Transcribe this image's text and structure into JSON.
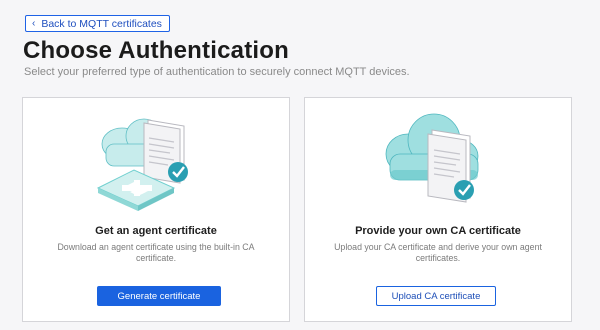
{
  "back_link": {
    "label": "Back to MQTT certificates"
  },
  "header": {
    "title": "Choose Authentication",
    "subtitle": "Select your preferred type of authentication to securely connect MQTT devices."
  },
  "cards": [
    {
      "title": "Get an agent certificate",
      "description": "Download an agent certificate using the built-in CA certificate.",
      "button_label": "Generate certificate"
    },
    {
      "title": "Provide your own CA certificate",
      "description": "Upload your CA certificate and derive your own agent certificates.",
      "button_label": "Upload CA certificate"
    }
  ],
  "colors": {
    "accent": "#1a63e0",
    "teal": "#6fd1cf",
    "teal_dark": "#2a9fb2"
  }
}
